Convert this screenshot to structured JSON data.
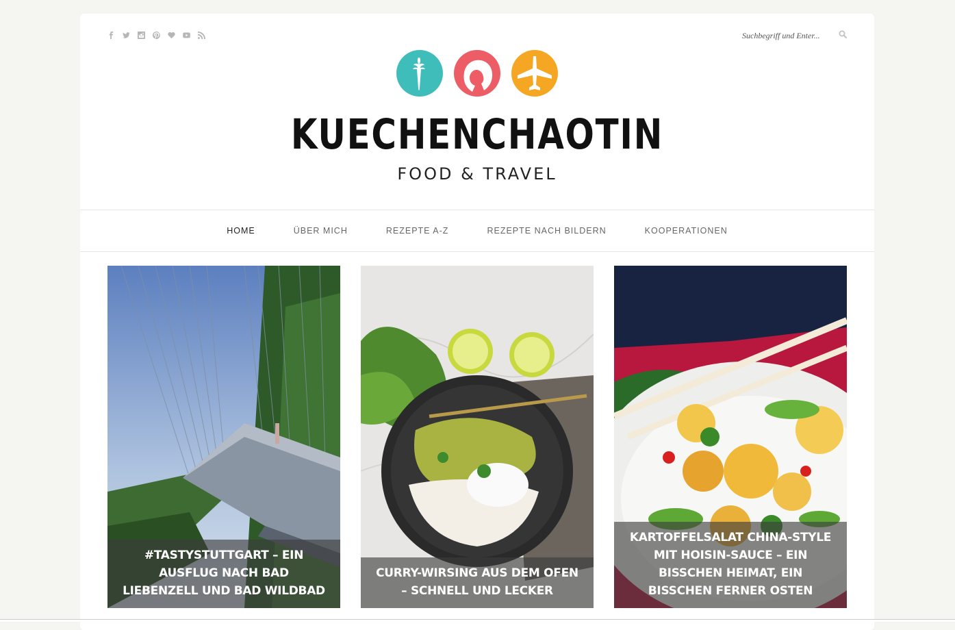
{
  "social": {
    "icons": [
      "facebook-icon",
      "twitter-icon",
      "instagram-icon",
      "pinterest-icon",
      "bloglovin-heart-icon",
      "youtube-icon",
      "rss-icon"
    ],
    "icon_color": "#b6b6b6"
  },
  "search": {
    "placeholder": "Suchbegriff und Enter...",
    "icon": "search-icon"
  },
  "logo": {
    "brand": "KUECHENCHAOTIN",
    "tagline": "FOOD & TRAVEL",
    "circle_colors": [
      "#3fbdbb",
      "#ec5d66",
      "#f5a623"
    ],
    "circle_icons": [
      "carrot-icon",
      "woman-profile-icon",
      "airplane-icon"
    ]
  },
  "nav": {
    "items": [
      {
        "label": "HOME",
        "active": true
      },
      {
        "label": "ÜBER MICH"
      },
      {
        "label": "REZEPTE A-Z"
      },
      {
        "label": "REZEPTE NACH BILDERN"
      },
      {
        "label": "KOOPERATIONEN"
      }
    ]
  },
  "posts": [
    {
      "title": "#TASTYSTUTTGART – EIN AUSFLUG NACH BAD LIEBENZELL UND BAD WILDBAD"
    },
    {
      "title": "CURRY-WIRSING AUS DEM OFEN – SCHNELL UND LECKER"
    },
    {
      "title": "KARTOFFELSALAT CHINA-STYLE MIT HOISIN-SAUCE – EIN BISSCHEN HEIMAT, EIN BISSCHEN FERNER OSTEN"
    }
  ]
}
